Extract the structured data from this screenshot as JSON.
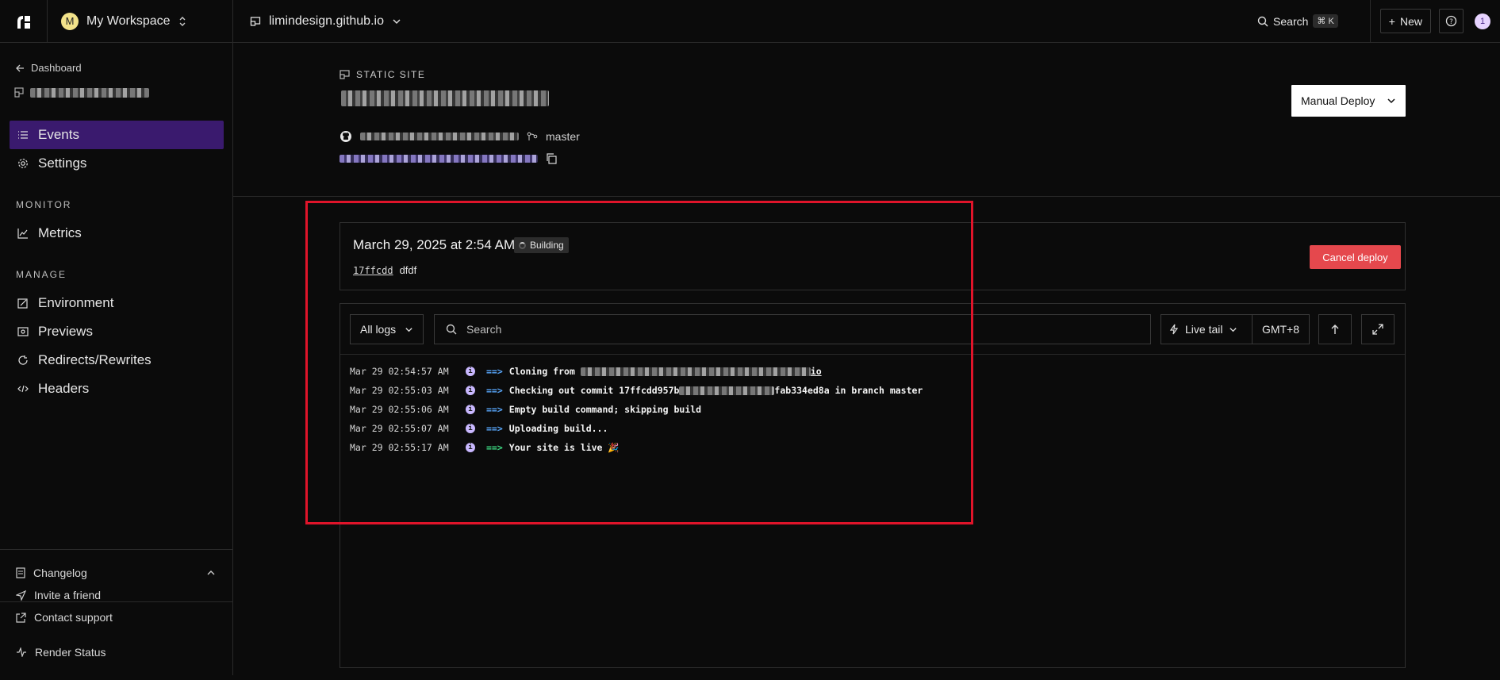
{
  "topbar": {
    "workspace_initial": "M",
    "workspace_name": "My Workspace",
    "site_name": "limindesign.github.io",
    "search_label": "Search",
    "search_shortcut": "⌘ K",
    "new_label": "New",
    "notification_count": "1"
  },
  "sidebar": {
    "back_label": "Dashboard",
    "items": [
      {
        "label": "Events",
        "icon": "list-icon",
        "active": true
      },
      {
        "label": "Settings",
        "icon": "gear-icon"
      }
    ],
    "monitor_label": "MONITOR",
    "monitor_items": [
      {
        "label": "Metrics",
        "icon": "chart-icon"
      }
    ],
    "manage_label": "MANAGE",
    "manage_items": [
      {
        "label": "Environment",
        "icon": "env-icon"
      },
      {
        "label": "Previews",
        "icon": "preview-icon"
      },
      {
        "label": "Redirects/Rewrites",
        "icon": "redirect-icon"
      },
      {
        "label": "Headers",
        "icon": "code-icon"
      }
    ],
    "footer": {
      "changelog": "Changelog",
      "invite": "Invite a friend",
      "support": "Contact support",
      "status": "Render Status"
    }
  },
  "service": {
    "type_label": "STATIC SITE",
    "branch": "master",
    "manual_deploy_label": "Manual Deploy"
  },
  "deploy": {
    "date": "March 29, 2025 at 2:54 AM",
    "status": "Building",
    "commit_hash": "17ffcdd",
    "commit_message": "dfdf",
    "cancel_label": "Cancel deploy"
  },
  "logs": {
    "filter_label": "All logs",
    "search_placeholder": "Search",
    "live_tail_label": "Live tail",
    "timezone": "GMT+8",
    "lines": [
      {
        "ts": "Mar 29 02:54:57 AM",
        "arrow": "==>",
        "msg": "Cloning from ",
        "tail": "io"
      },
      {
        "ts": "Mar 29 02:55:03 AM",
        "arrow": "==>",
        "msg": "Checking out commit 17ffcdd957b",
        "tail": "fab334ed8a in branch master"
      },
      {
        "ts": "Mar 29 02:55:06 AM",
        "arrow": "==>",
        "msg": "Empty build command; skipping build",
        "tail": ""
      },
      {
        "ts": "Mar 29 02:55:07 AM",
        "arrow": "==>",
        "msg": "Uploading build...",
        "tail": ""
      },
      {
        "ts": "Mar 29 02:55:17 AM",
        "arrow": "==>",
        "msg": "Your site is live 🎉",
        "tail": ""
      }
    ]
  }
}
